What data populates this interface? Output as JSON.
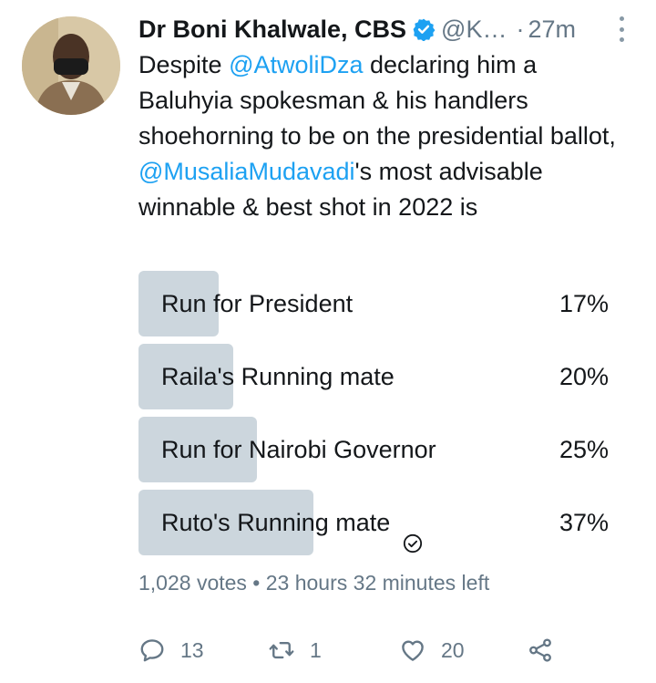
{
  "tweet": {
    "author_name": "Dr Boni Khalwale, CBS",
    "handle": "@K…",
    "time_sep": "·",
    "time": "27m",
    "text_segments": [
      {
        "text": "Despite ",
        "type": "text"
      },
      {
        "text": "@AtwoliDza",
        "type": "mention"
      },
      {
        "text": " declaring him a Baluhyia spokesman & his handlers shoehorning to be on the presidential ballot, ",
        "type": "text"
      },
      {
        "text": "@MusaliaMudavadi",
        "type": "mention"
      },
      {
        "text": "'s most advisable winnable & best shot in 2022 is",
        "type": "text"
      }
    ]
  },
  "poll": {
    "options": [
      {
        "label": "Run for President",
        "pct_label": "17%",
        "value": 17,
        "selected": false
      },
      {
        "label": "Raila's Running mate",
        "pct_label": "20%",
        "value": 20,
        "selected": false
      },
      {
        "label": "Run for Nairobi Governor",
        "pct_label": "25%",
        "value": 25,
        "selected": false
      },
      {
        "label": "Ruto's Running mate",
        "pct_label": "37%",
        "value": 37,
        "selected": true
      }
    ],
    "footer": "1,028 votes • 23 hours 32 minutes left"
  },
  "actions": {
    "reply_count": "13",
    "retweet_count": "1",
    "like_count": "20"
  },
  "colors": {
    "accent": "#1da1f2",
    "poll_fill": "#ccd6dd",
    "secondary_text": "#657786"
  },
  "icons": [
    "verified-badge-icon",
    "more-options-icon",
    "check-circle-icon",
    "reply-icon",
    "retweet-icon",
    "like-icon",
    "share-icon"
  ]
}
